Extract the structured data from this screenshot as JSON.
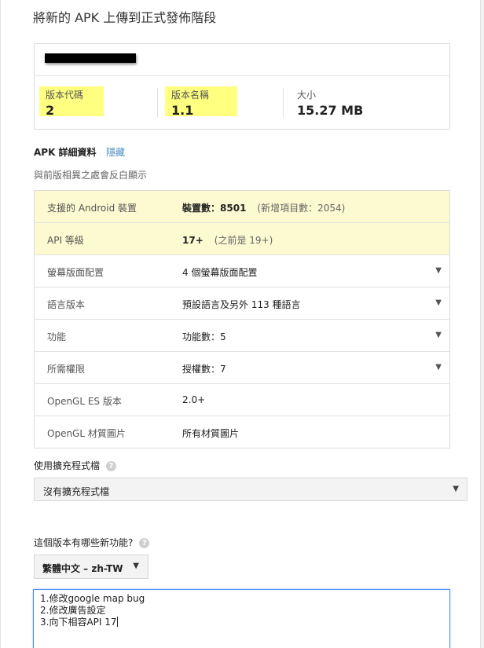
{
  "header": {
    "title": "將新的 APK 上傳到正式發佈階段"
  },
  "summary": {
    "redacted": true,
    "version_code": {
      "label": "版本代碼",
      "value": "2",
      "highlight": "#ffff80"
    },
    "version_name": {
      "label": "版本名稱",
      "value": "1.1",
      "highlight": "#ffff80"
    },
    "size": {
      "label": "大小",
      "value": "15.27 MB"
    }
  },
  "apk_details": {
    "heading": "APK 詳細資料",
    "hide_link": "隱藏",
    "subtitle": "與前版相異之處會反白顯示",
    "rows": [
      {
        "key": "支援的 Android 裝置",
        "value_bold_prefix": "裝置數：",
        "value_bold": "8501",
        "note": "(新增項目數：2054)",
        "highlighted": true,
        "dropdown": false
      },
      {
        "key": "API 等級",
        "value_bold_prefix": "",
        "value_bold": "17+",
        "note": "(之前是 19+)",
        "highlighted": true,
        "dropdown": false
      },
      {
        "key": "螢幕版面配置",
        "value": "4 個螢幕版面配置",
        "highlighted": false,
        "dropdown": true
      },
      {
        "key": "語言版本",
        "value": "預設語言及另外 113 種語言",
        "highlighted": false,
        "dropdown": true
      },
      {
        "key": "功能",
        "value": "功能數：5",
        "highlighted": false,
        "dropdown": true
      },
      {
        "key": "所需權限",
        "value": "授權數：7",
        "highlighted": false,
        "dropdown": true
      },
      {
        "key": "OpenGL ES 版本",
        "value": "2.0+",
        "highlighted": false,
        "dropdown": false
      },
      {
        "key": "OpenGL 材質圖片",
        "value": "所有材質圖片",
        "highlighted": false,
        "dropdown": false
      }
    ]
  },
  "expansion": {
    "label": "使用擴充程式檔",
    "help_icon": "question-circle-icon",
    "selected": "沒有擴充程式檔"
  },
  "whats_new": {
    "label": "這個版本有哪些新功能?",
    "language_selected": "繁體中文 – zh-TW",
    "notes": [
      "1.修改google map bug",
      "2.修改廣告設定",
      "3.向下相容API 17"
    ]
  },
  "colors": {
    "highlight_row": "#fdf9d0",
    "highlight_stat": "#ffff80",
    "link": "#4a90c0",
    "focus": "#4d90fe"
  },
  "icons": {
    "dropdown": "triangle-down-icon",
    "help": "question-circle-icon"
  }
}
